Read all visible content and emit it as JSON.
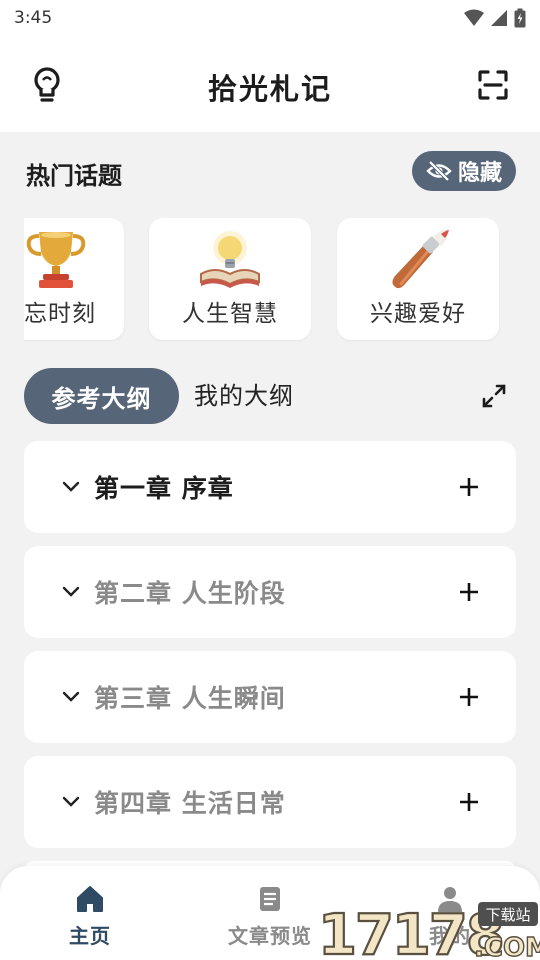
{
  "status_bar": {
    "time": "3:45"
  },
  "header": {
    "title": "拾光札记",
    "left_icon": "lightbulb-icon",
    "right_icon": "scan-icon"
  },
  "topics": {
    "title": "热门话题",
    "hide_label": "隐藏",
    "items": [
      {
        "label": "忘时刻",
        "icon": "trophy-icon"
      },
      {
        "label": "人生智慧",
        "icon": "lightbulb-book-icon"
      },
      {
        "label": "兴趣爱好",
        "icon": "paintbrush-icon"
      }
    ]
  },
  "outline_tabs": {
    "reference": "参考大纲",
    "mine": "我的大纲"
  },
  "chapters": [
    {
      "title": "第一章 序章"
    },
    {
      "title": "第二章 人生阶段"
    },
    {
      "title": "第三章 人生瞬间"
    },
    {
      "title": "第四章 生活日常"
    }
  ],
  "bottom_nav": {
    "items": [
      {
        "label": "主页",
        "icon": "home-icon"
      },
      {
        "label": "文章预览",
        "icon": "document-icon"
      },
      {
        "label": "我的",
        "icon": "user-icon"
      }
    ]
  },
  "watermark": {
    "text": "17178",
    "badge": "下载站",
    "suffix": ".COM"
  },
  "colors": {
    "accent": "#566577",
    "nav_active": "#2f4a63",
    "muted_text": "#8a8a8a"
  }
}
